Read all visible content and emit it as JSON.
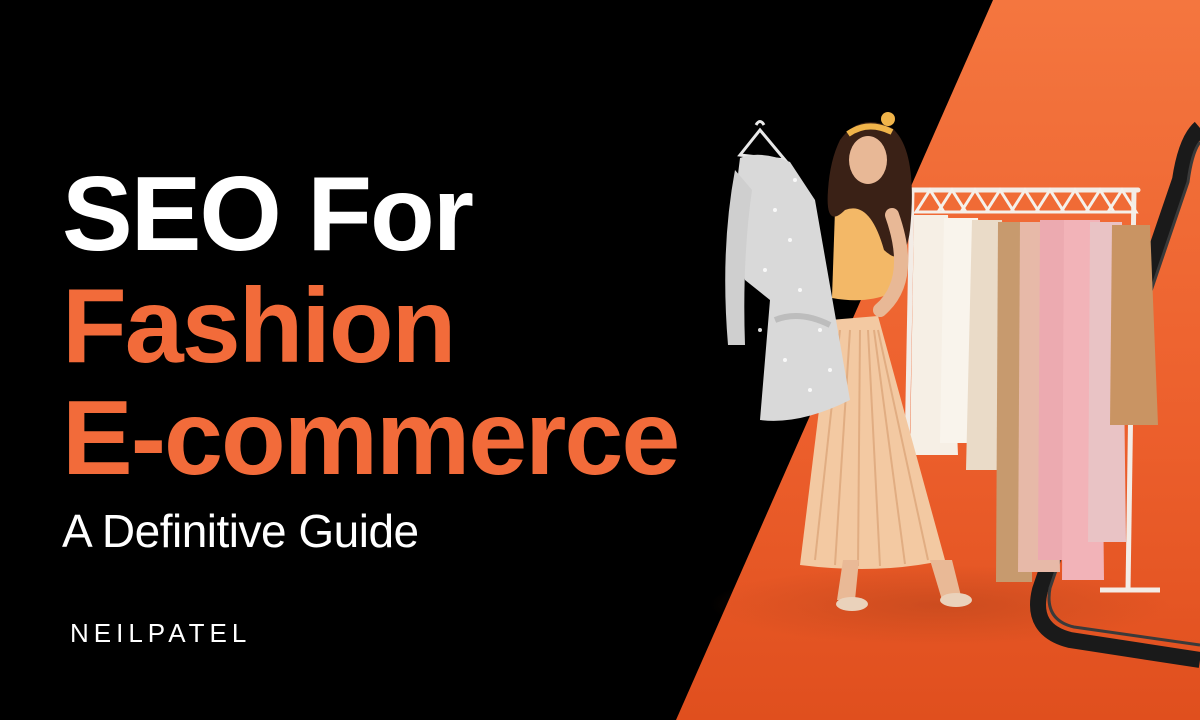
{
  "banner": {
    "title_line1": "SEO For",
    "title_line2": "Fashion",
    "title_line3": "E-commerce",
    "subtitle": "A Definitive Guide",
    "brand": "NEILPATEL"
  },
  "colors": {
    "background": "#000000",
    "accent": "#f26b3a",
    "accent_light": "#f47a45",
    "accent_dark": "#e45220",
    "text": "#ffffff"
  }
}
